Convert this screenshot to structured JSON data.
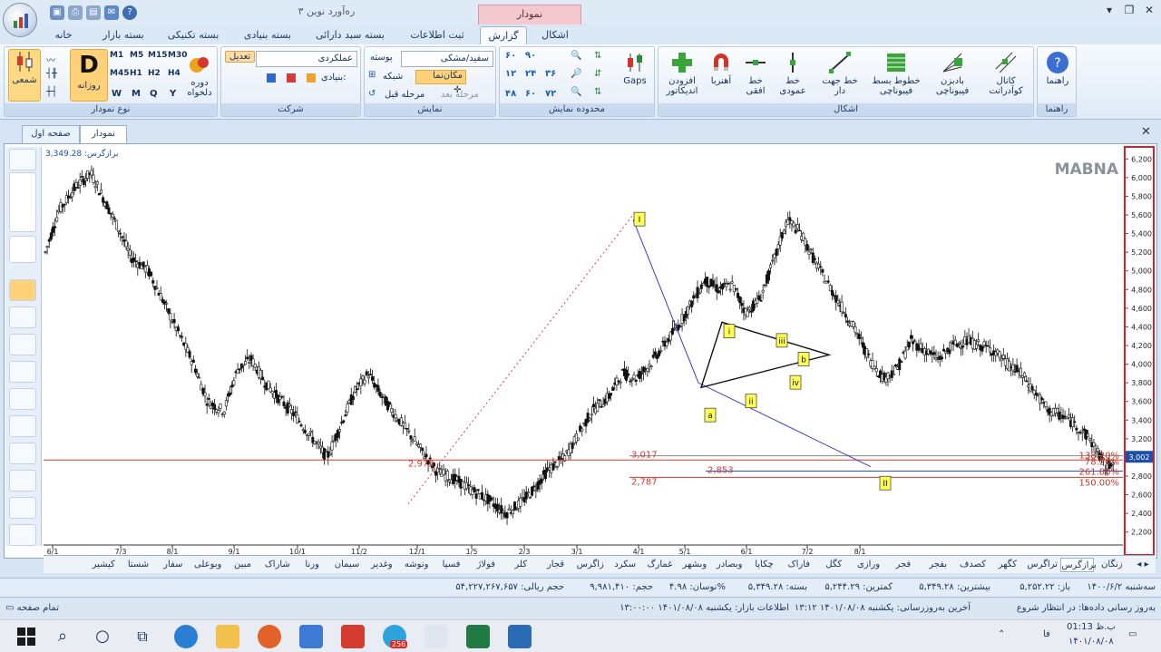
{
  "app": {
    "title": "ره‌آورد نوین ۳",
    "context_tab": "نمودار"
  },
  "ribbon_tabs": [
    "خانه",
    "بسته بازار",
    "بسته تکنیکی",
    "بسته بنیادی",
    "بسته سبد دارائی",
    "ثبت اطلاعات",
    "گزارش",
    "اشکال"
  ],
  "groups": {
    "chart_type": {
      "title": "نوع نمودار",
      "candle": "شمعی",
      "daily_letter": "D",
      "daily": "روزانه",
      "period": "دوره دلخواه",
      "intervals": [
        "M1",
        "M5",
        "M15",
        "M30",
        "M45",
        "H1",
        "H2",
        "H4",
        "W",
        "M",
        "Q",
        "Y"
      ]
    },
    "company": {
      "title": "شرکت",
      "performance": "عملکردی",
      "adjust": "تعدیل",
      "fundamental": "بنیادی:"
    },
    "display": {
      "title": "نمایش",
      "theme": "سفید/مشکی",
      "background": "پوسته",
      "cursor": "مکان‌نما",
      "grid": "شبکه",
      "prev": "مرحله قبل",
      "next": "مرحله بعد"
    },
    "range": {
      "title": "محدوده نمایش",
      "nums": [
        "۶۰",
        "۹۰",
        "۱۲",
        "۲۴",
        "۳۶",
        "۴۸",
        "۶۰",
        "۷۲"
      ]
    },
    "gaps": "Gaps",
    "shapes": {
      "title": "اشکال",
      "add_indicator": "افزودن اندیکاتور",
      "magnet": "آهنربا",
      "horizontal": "خط افقی",
      "vertical": "خط عمودی",
      "trendline": "خط جهت دار",
      "fib_ext": "خطوط بسط فیبوناچی",
      "fib_fan": "بادبزن فیبوناچی",
      "quad_channel": "کانال کوآدرانت"
    },
    "help": {
      "title": "راهنما",
      "label": "راهنما"
    }
  },
  "doc_tabs": [
    "صفحه اول",
    "نمودار"
  ],
  "chart": {
    "index_label": "برازگرس: 3,349.28",
    "watermark": "MABNA",
    "last_price": "3,002",
    "levels": {
      "l2973": "2,973",
      "l3017": "3,017",
      "l2853": "2,853",
      "l2787": "2,787"
    },
    "fib_labels": {
      "f138": "138.20%",
      "f78": "78.20%",
      "f261": "261.80%",
      "f150": "150.00%"
    },
    "wave_labels": [
      "i",
      "a",
      "ii",
      "iii",
      "iv",
      "b",
      "II"
    ],
    "wave_top": "I"
  },
  "chart_data": {
    "type": "candlestick",
    "y_ticks": [
      2200,
      2400,
      2600,
      2800,
      3000,
      3200,
      3400,
      3600,
      3800,
      4000,
      4200,
      4400,
      4600,
      4800,
      5000,
      5200,
      5400,
      5600,
      5800,
      6000,
      6200
    ],
    "x_ticks": [
      "6/1",
      "7/3",
      "8/1",
      "9/1",
      "10/1",
      "11/2",
      "12/1",
      "1/5",
      "2/3",
      "3/1",
      "4/1",
      "5/1",
      "6/1",
      "7/2",
      "8/1"
    ],
    "ylim": [
      2100,
      6300
    ],
    "close_path": [
      [
        0,
        5200
      ],
      [
        10,
        5650
      ],
      [
        22,
        5900
      ],
      [
        33,
        6050
      ],
      [
        45,
        5700
      ],
      [
        55,
        5400
      ],
      [
        62,
        5150
      ],
      [
        75,
        5000
      ],
      [
        85,
        4700
      ],
      [
        98,
        4300
      ],
      [
        108,
        4000
      ],
      [
        118,
        3600
      ],
      [
        130,
        3500
      ],
      [
        140,
        3950
      ],
      [
        150,
        4050
      ],
      [
        160,
        3800
      ],
      [
        172,
        3600
      ],
      [
        182,
        3450
      ],
      [
        192,
        3250
      ],
      [
        205,
        3000
      ],
      [
        215,
        3350
      ],
      [
        225,
        3700
      ],
      [
        235,
        3900
      ],
      [
        245,
        3650
      ],
      [
        255,
        3450
      ],
      [
        265,
        3250
      ],
      [
        275,
        3050
      ],
      [
        285,
        2850
      ],
      [
        300,
        2750
      ],
      [
        310,
        2650
      ],
      [
        322,
        2550
      ],
      [
        335,
        2400
      ],
      [
        345,
        2500
      ],
      [
        355,
        2650
      ],
      [
        365,
        2850
      ],
      [
        378,
        3000
      ],
      [
        388,
        3250
      ],
      [
        398,
        3500
      ],
      [
        410,
        3650
      ],
      [
        420,
        3900
      ],
      [
        430,
        3850
      ],
      [
        440,
        4000
      ],
      [
        450,
        4200
      ],
      [
        460,
        4400
      ],
      [
        470,
        4650
      ],
      [
        480,
        4900
      ],
      [
        490,
        4800
      ],
      [
        500,
        4850
      ],
      [
        510,
        4550
      ],
      [
        520,
        4700
      ],
      [
        530,
        5100
      ],
      [
        540,
        5550
      ],
      [
        550,
        5400
      ],
      [
        560,
        5100
      ],
      [
        570,
        4850
      ],
      [
        580,
        4600
      ],
      [
        590,
        4350
      ],
      [
        600,
        4050
      ],
      [
        610,
        3850
      ],
      [
        620,
        3950
      ],
      [
        630,
        4250
      ],
      [
        640,
        4150
      ],
      [
        650,
        4050
      ],
      [
        660,
        4200
      ],
      [
        670,
        4250
      ],
      [
        680,
        4200
      ],
      [
        690,
        4150
      ],
      [
        700,
        4000
      ],
      [
        710,
        3900
      ],
      [
        720,
        3700
      ],
      [
        730,
        3500
      ],
      [
        740,
        3450
      ],
      [
        750,
        3350
      ],
      [
        760,
        3200
      ],
      [
        768,
        3000
      ],
      [
        772,
        2870
      ],
      [
        778,
        3002
      ]
    ],
    "fib_levels": [
      {
        "label": "138.20%",
        "value": 3017
      },
      {
        "label": "78.20%",
        "value": 2973
      },
      {
        "label": "261.80%",
        "value": 2853
      },
      {
        "label": "150.00%",
        "value": 2787
      }
    ],
    "waves": [
      {
        "label": "I",
        "value": 5550
      },
      {
        "label": "i",
        "value": 4350
      },
      {
        "label": "a",
        "value": 3450
      },
      {
        "label": "ii",
        "value": 3600
      },
      {
        "label": "iii",
        "value": 4250
      },
      {
        "label": "iv",
        "value": 3800
      },
      {
        "label": "b",
        "value": 4050
      },
      {
        "label": "II",
        "value": 2720
      }
    ]
  },
  "symbols": [
    "زنگان",
    "برازگرس",
    "تراگرس",
    "کگهر",
    "کصدف",
    "بفجر",
    "فجر",
    "ورازی",
    "کگل",
    "فاراک",
    "چکاپا",
    "وبصادر",
    "وبشهر",
    "غمارگ",
    "سکرد",
    "زاگرس",
    "قجار",
    "کلر",
    "فولاژ",
    "فسپا",
    "ونوشه",
    "وغدیر",
    "سیمان",
    "ورنا",
    "شاراک",
    "مبین",
    "وبوعلی",
    "سفار",
    "شستا",
    "کیشیر"
  ],
  "info": {
    "date": "سه‌شنبه ۱۴۰۰/۶/۲",
    "open": "باز: ۵,۲۵۲.۲۲",
    "high": "بیشترین: ۵,۳۴۹.۲۸",
    "low": "کمترین: ۵,۲۴۴.۲۹",
    "close": "بسته: ۵,۳۴۹.۲۸",
    "change": "نوسان: ۴.۹۸%",
    "volume": "حجم: ۹,۹۸۱,۴۱۰",
    "value": "حجم ریالی: ۵۴,۲۲۷,۲۶۷,۶۵۷"
  },
  "status": {
    "fullscreen": "تمام صفحه",
    "update": "به‌روز رسانی داده‌ها: در انتظار شروع",
    "last_update": "آخرین به‌روز‌رسانی: یکشنبه ۱۴۰۱/۰۸/۰۸ ۱۳:۱۲",
    "market": "اطلاعات بازار: یکشنبه ۱۴۰۱/۰۸/۰۸ ۱۳:۰۰:۰۰"
  },
  "taskbar": {
    "time": "01:13 ب.ظ",
    "date": "۱۴۰۱/۰۸/۰۸",
    "lang": "فا",
    "badge": "256"
  }
}
